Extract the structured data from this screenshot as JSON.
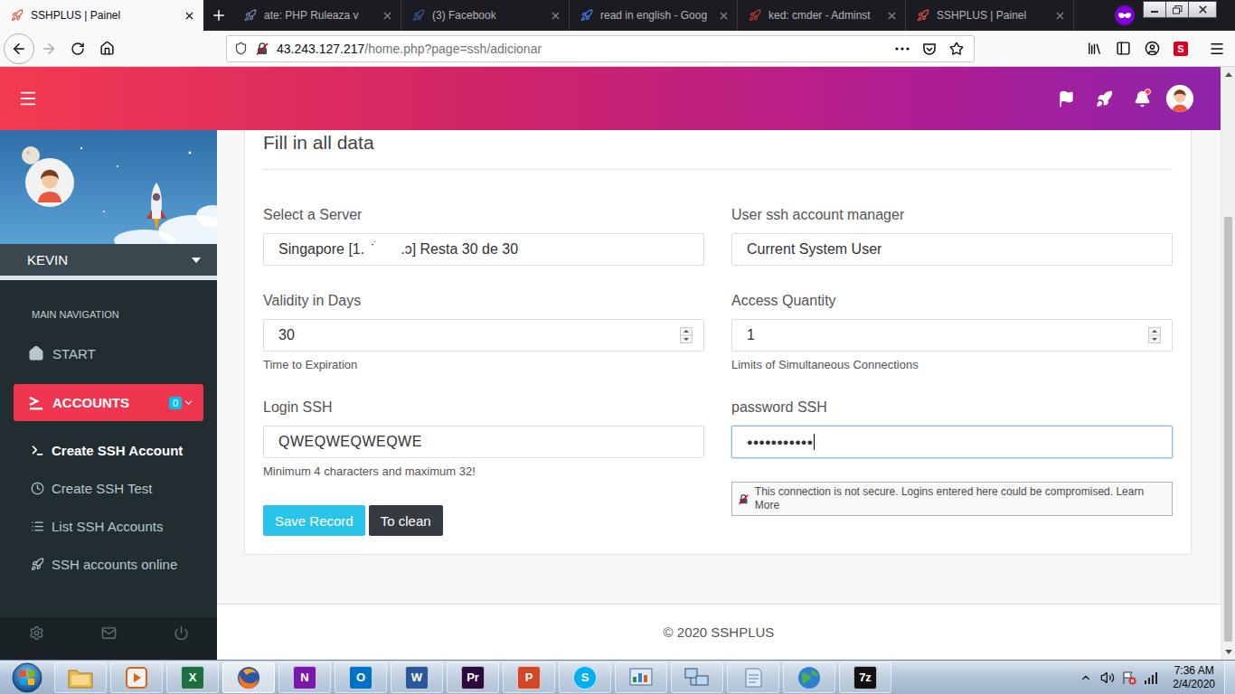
{
  "browser": {
    "tabs": [
      {
        "title": "SSHPLUS | Painel",
        "selected": true,
        "color": "#e5533d"
      },
      {
        "title": "ate: PHP Ruleaza v",
        "selected": false,
        "color": "#7a86b8"
      },
      {
        "title": "(3) Facebook",
        "selected": false,
        "color": "#3b5998"
      },
      {
        "title": "read in english - Goog",
        "selected": false,
        "color": "#4285f4"
      },
      {
        "title": "ked: cmder - Adminst",
        "selected": false,
        "color": "#c0392b"
      },
      {
        "title": "SSHPLUS | Painel",
        "selected": false,
        "color": "#e5533d"
      }
    ],
    "forward_enabled": false,
    "url": {
      "host": "43.243.127.217",
      "path": "/home.php?page=ssh/adicionar",
      "secure": false
    },
    "extension_badge": "S"
  },
  "header": {
    "notifications_unread": true
  },
  "sidebar": {
    "user": "KEVIN",
    "section": "MAIN NAVIGATION",
    "items": [
      {
        "label": "START",
        "selected": false
      },
      {
        "label": "ACCOUNTS",
        "selected": true,
        "badge": "0",
        "expanded": true
      }
    ],
    "subitems": [
      {
        "label": "Create SSH Account",
        "selected": true
      },
      {
        "label": "Create SSH Test",
        "selected": false
      },
      {
        "label": "List SSH Accounts",
        "selected": false
      },
      {
        "label": "SSH accounts online",
        "selected": false
      }
    ]
  },
  "form": {
    "title": "Fill in all data",
    "fields": [
      {
        "label": "Select a Server",
        "value": "Singapore [1.  ̇ ́      .ɔ] Resta 30 de 30",
        "kind": "select",
        "focused": false
      },
      {
        "label": "User ssh account manager",
        "value": "Current System User",
        "kind": "select",
        "focused": false
      },
      {
        "label": "Validity in Days",
        "value": "30",
        "kind": "number",
        "help": "Time to Expiration",
        "focused": false
      },
      {
        "label": "Access Quantity",
        "value": "1",
        "kind": "number",
        "help": "Limits of Simultaneous Connections",
        "focused": false
      },
      {
        "label": "Login SSH",
        "value": "QWEQWEQWEQWE",
        "kind": "text",
        "help": "Minimum 4 characters and maximum 32!",
        "focused": false
      },
      {
        "label": "password SSH",
        "value": "●●●●●●●●●●●",
        "kind": "password",
        "focused": true
      }
    ],
    "buttons": [
      {
        "label": "Save Record",
        "kind": "primary"
      },
      {
        "label": "To clean",
        "kind": "secondary"
      }
    ]
  },
  "tooltip": {
    "message": "This connection is not secure. Logins entered here could be compromised.",
    "link": "Learn More"
  },
  "footer": "© 2020 SSHPLUS",
  "taskbar": {
    "apps": [
      {
        "kind": "folder",
        "selected": false
      },
      {
        "kind": "media",
        "selected": false
      },
      {
        "kind": "tile",
        "glyph": "X",
        "color": "#1d6f42",
        "selected": false
      },
      {
        "kind": "firefox",
        "selected": true
      },
      {
        "kind": "tile",
        "glyph": "N",
        "color": "#7719aa",
        "selected": false
      },
      {
        "kind": "tile",
        "glyph": "O",
        "color": "#0072c6",
        "selected": false
      },
      {
        "kind": "tile",
        "glyph": "W",
        "color": "#2b579a",
        "selected": false
      },
      {
        "kind": "tile",
        "glyph": "Pr",
        "color": "#2a0a3d",
        "selected": false
      },
      {
        "kind": "tile",
        "glyph": "P",
        "color": "#d24726",
        "selected": false
      },
      {
        "kind": "round",
        "glyph": "S",
        "color": "#00aff0",
        "selected": false
      },
      {
        "kind": "panel",
        "selected": false
      },
      {
        "kind": "network",
        "selected": false
      },
      {
        "kind": "notepad",
        "selected": false
      },
      {
        "kind": "globe",
        "selected": false
      },
      {
        "kind": "tile",
        "glyph": "7z",
        "color": "#111111",
        "selected": false
      }
    ],
    "clock": {
      "time": "7:36 AM",
      "date": "2/4/2020"
    }
  }
}
